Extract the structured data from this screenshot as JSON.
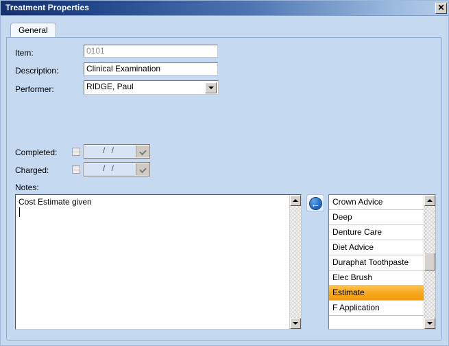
{
  "window": {
    "title": "Treatment Properties",
    "close_label": "✕"
  },
  "tabs": [
    {
      "label": "General",
      "active": true
    }
  ],
  "form": {
    "item": {
      "label": "Item:",
      "value": "0101",
      "readonly": true
    },
    "description": {
      "label": "Description:",
      "value": "Clinical Examination"
    },
    "performer": {
      "label": "Performer:",
      "value": "RIDGE, Paul"
    },
    "completed": {
      "label": "Completed:",
      "checked": false,
      "date_value": "  /     /  "
    },
    "charged": {
      "label": "Charged:",
      "checked": false,
      "date_value": "  /     /  "
    },
    "notes": {
      "label": "Notes:",
      "value": "Cost Estimate given"
    }
  },
  "nav_button": {
    "icon": "arrow-left-circle-icon",
    "glyph": "←"
  },
  "suggestion_list": {
    "items": [
      {
        "label": "Crown Advice",
        "selected": false
      },
      {
        "label": "Deep",
        "selected": false
      },
      {
        "label": "Denture Care",
        "selected": false
      },
      {
        "label": "Diet Advice",
        "selected": false
      },
      {
        "label": "Duraphat Toothpaste",
        "selected": false
      },
      {
        "label": "Elec Brush",
        "selected": false
      },
      {
        "label": "Estimate",
        "selected": true
      },
      {
        "label": "F Application",
        "selected": false
      }
    ],
    "selected_value": "Estimate"
  },
  "colors": {
    "dialog_background": "#c5d9f1",
    "title_gradient_start": "#16306f",
    "title_gradient_end": "#b6cce7",
    "selection_highlight": "#f6a81e",
    "field_background": "#ffffff",
    "disabled_text": "#8a8a8a"
  }
}
